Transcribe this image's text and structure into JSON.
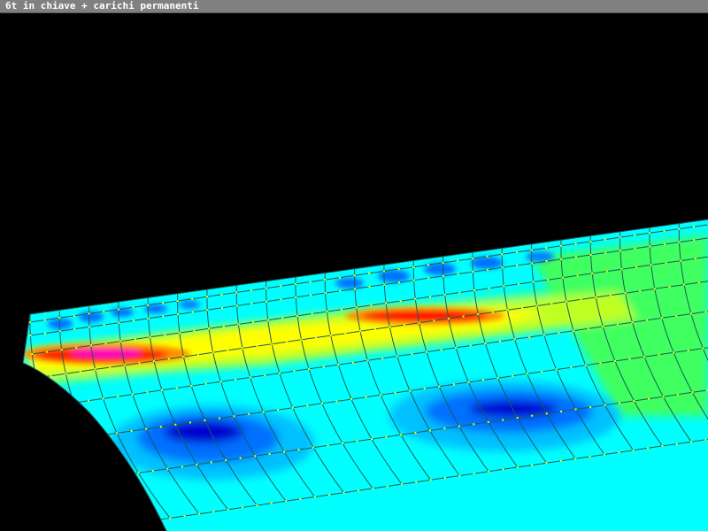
{
  "window": {
    "title": "6t in chiave + carichi permanenti"
  },
  "view": {
    "background": "#000000",
    "titlebar_color": "#808080",
    "mesh_line_color": "#1a5a5a",
    "node_color": "#ffff00"
  },
  "contour_palette": {
    "cyan": "#00ffff",
    "light_blue": "#00c0ff",
    "blue": "#0060ff",
    "dark_blue": "#0000c8",
    "green": "#00ff80",
    "yellow": "#ffff00",
    "orange": "#ff8000",
    "red": "#ff0000",
    "magenta": "#ff00ff"
  }
}
